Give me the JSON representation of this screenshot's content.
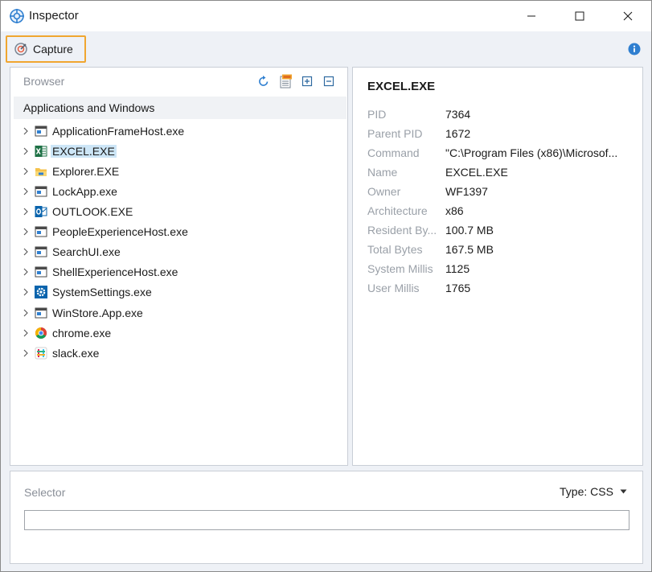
{
  "window": {
    "title": "Inspector"
  },
  "toolbar": {
    "capture_label": "Capture"
  },
  "browser": {
    "title": "Browser",
    "root_label": "Applications and Windows",
    "items": [
      {
        "label": "ApplicationFrameHost.exe",
        "icon": "window-app-icon"
      },
      {
        "label": "EXCEL.EXE",
        "icon": "excel-icon",
        "selected": true
      },
      {
        "label": "Explorer.EXE",
        "icon": "explorer-folder-icon"
      },
      {
        "label": "LockApp.exe",
        "icon": "window-app-icon"
      },
      {
        "label": "OUTLOOK.EXE",
        "icon": "outlook-icon"
      },
      {
        "label": "PeopleExperienceHost.exe",
        "icon": "window-app-icon"
      },
      {
        "label": "SearchUI.exe",
        "icon": "window-app-icon"
      },
      {
        "label": "ShellExperienceHost.exe",
        "icon": "window-app-icon"
      },
      {
        "label": "SystemSettings.exe",
        "icon": "settings-gear-icon"
      },
      {
        "label": "WinStore.App.exe",
        "icon": "window-app-icon"
      },
      {
        "label": "chrome.exe",
        "icon": "chrome-icon"
      },
      {
        "label": "slack.exe",
        "icon": "slack-icon"
      }
    ]
  },
  "details": {
    "title": "EXCEL.EXE",
    "properties": [
      {
        "key": "PID",
        "value": "7364"
      },
      {
        "key": "Parent PID",
        "value": "1672"
      },
      {
        "key": "Command",
        "value": "\"C:\\Program Files (x86)\\Microsof..."
      },
      {
        "key": "Name",
        "value": "EXCEL.EXE"
      },
      {
        "key": "Owner",
        "value": "WF1397"
      },
      {
        "key": "Architecture",
        "value": "x86"
      },
      {
        "key": "Resident By...",
        "value": "100.7 MB"
      },
      {
        "key": "Total Bytes",
        "value": "167.5 MB"
      },
      {
        "key": "System Millis",
        "value": "1125"
      },
      {
        "key": "User Millis",
        "value": "1765"
      }
    ]
  },
  "selector": {
    "title": "Selector",
    "type_label": "Type: CSS",
    "value": ""
  },
  "colors": {
    "accent_orange": "#f0a630",
    "selection_blue": "#cde6f7",
    "panel_bg": "#eef1f6"
  }
}
